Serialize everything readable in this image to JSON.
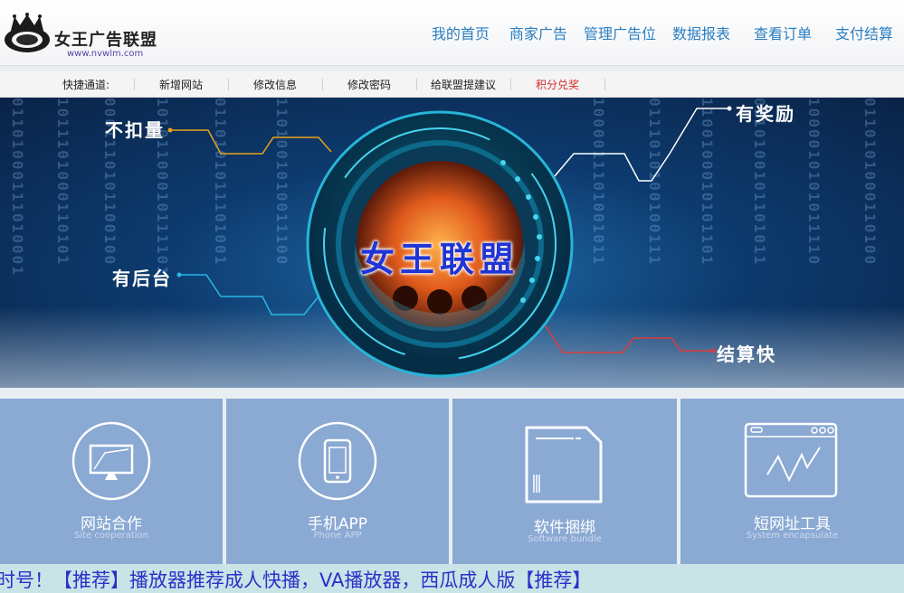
{
  "header": {
    "logo_title": "女王广告联盟",
    "logo_url": "www.nvwlm.com",
    "nav": [
      "我的首页",
      "商家广告",
      "管理广告位",
      "数据报表",
      "查看订单",
      "支付结算"
    ]
  },
  "quick": {
    "label": "快捷通道:",
    "items": [
      "新增网站",
      "修改信息",
      "修改密码",
      "给联盟提建议",
      "积分兑奖"
    ]
  },
  "banner": {
    "center_text": "女王联盟",
    "labels": [
      "不扣量",
      "有后台",
      "有奖励",
      "结算快"
    ]
  },
  "tiles": [
    {
      "title": "网站合作",
      "subtitle": "Site cooperation",
      "icon": "monitor-icon"
    },
    {
      "title": "手机APP",
      "subtitle": "Phone APP",
      "icon": "phone-icon"
    },
    {
      "title": "软件捆绑",
      "subtitle": "Software bundle",
      "icon": "sd-card-icon"
    },
    {
      "title": "短网址工具",
      "subtitle": "System encapsulate",
      "icon": "browser-chart-icon"
    }
  ],
  "marquee": "时号！【推荐】播放器推荐成人快播，VA播放器，西瓜成人版【推荐】",
  "colors": {
    "nav": "#2a7ec0",
    "tile": "#8aa9d3",
    "marquee_text": "#2a30c8",
    "highlight": "#d42b2b"
  }
}
